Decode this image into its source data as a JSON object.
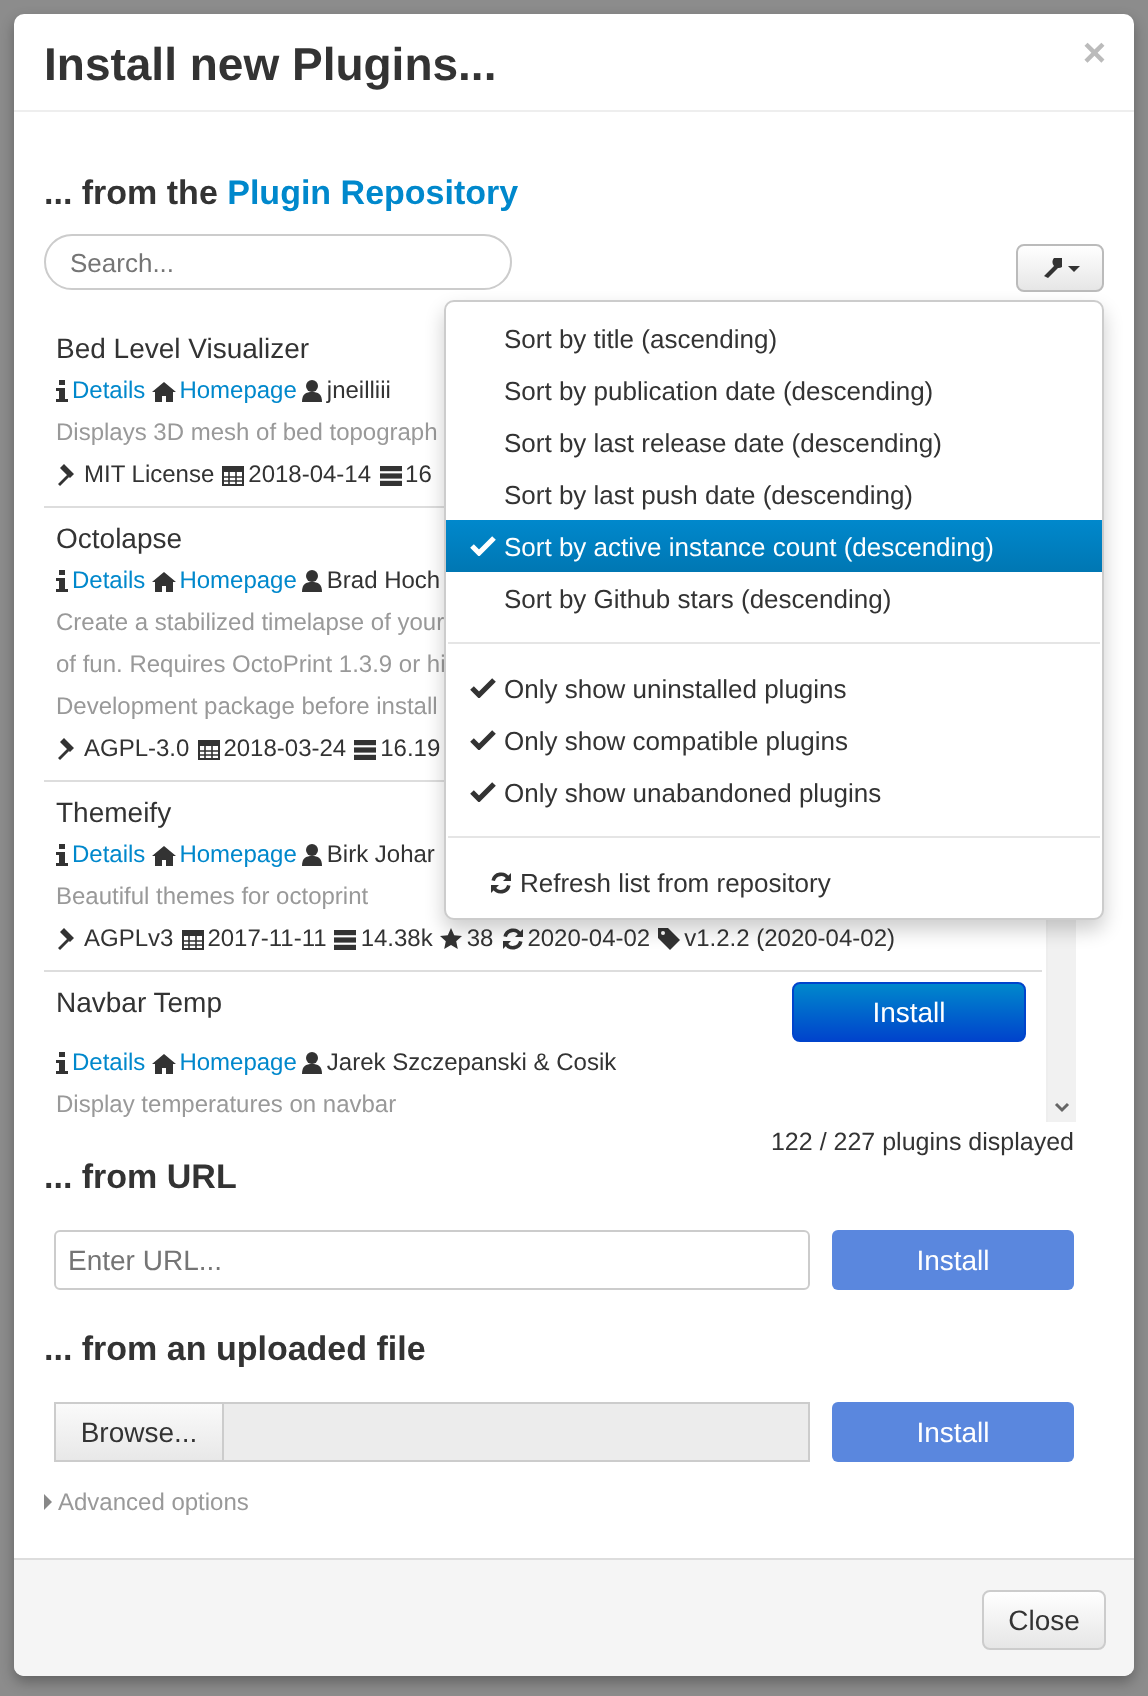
{
  "dialog": {
    "title": "Install new Plugins...",
    "close": "×"
  },
  "repository": {
    "heading": "... from the ",
    "heading_link": "Plugin Repository",
    "search_placeholder": "Search...",
    "plugins": [
      {
        "title": "Bed Level Visualizer",
        "details": "Details",
        "homepage": "Homepage",
        "author": "jneilliii",
        "description": [
          "Displays 3D mesh of bed topograph"
        ],
        "meta": [
          {
            "kind": "license",
            "text": "MIT License"
          },
          {
            "kind": "date",
            "text": "2018-04-14"
          },
          {
            "kind": "instances",
            "text": "16"
          }
        ]
      },
      {
        "title": "Octolapse",
        "details": "Details",
        "homepage": "Homepage",
        "author": "Brad Hoch",
        "description": [
          "Create a stabilized timelapse of your",
          "of fun. Requires OctoPrint 1.3.9 or hi",
          "Development package before install"
        ],
        "meta": [
          {
            "kind": "license",
            "text": "AGPL-3.0"
          },
          {
            "kind": "date",
            "text": "2018-03-24"
          },
          {
            "kind": "instances",
            "text": "16.19"
          }
        ]
      },
      {
        "title": "Themeify",
        "details": "Details",
        "homepage": "Homepage",
        "author": "Birk Johar",
        "description": [
          "Beautiful themes for octoprint"
        ],
        "meta": [
          {
            "kind": "license",
            "text": "AGPLv3"
          },
          {
            "kind": "date",
            "text": "2017-11-11"
          },
          {
            "kind": "instances",
            "text": "14.38k"
          },
          {
            "kind": "stars",
            "text": "38"
          },
          {
            "kind": "updated",
            "text": "2020-04-02"
          },
          {
            "kind": "version",
            "text": "v1.2.2 (2020-04-02)"
          }
        ]
      },
      {
        "title": "Navbar Temp",
        "install": "Install",
        "details": "Details",
        "homepage": "Homepage",
        "author": "Jarek Szczepanski & Cosik",
        "description": [
          "Display temperatures on navbar"
        ]
      }
    ],
    "count": "122 / 227 plugins displayed",
    "menu": {
      "sort_options": [
        {
          "label": "Sort by title (ascending)",
          "selected": false
        },
        {
          "label": "Sort by publication date (descending)",
          "selected": false
        },
        {
          "label": "Sort by last release date (descending)",
          "selected": false
        },
        {
          "label": "Sort by last push date (descending)",
          "selected": false
        },
        {
          "label": "Sort by active instance count (descending)",
          "selected": true
        },
        {
          "label": "Sort by Github stars (descending)",
          "selected": false
        }
      ],
      "filters": [
        {
          "label": "Only show uninstalled plugins",
          "checked": true
        },
        {
          "label": "Only show compatible plugins",
          "checked": true
        },
        {
          "label": "Only show unabandoned plugins",
          "checked": true
        }
      ],
      "refresh": "Refresh list from repository"
    }
  },
  "url": {
    "heading": "... from URL",
    "placeholder": "Enter URL...",
    "install": "Install"
  },
  "upload": {
    "heading": "... from an uploaded file",
    "browse": "Browse...",
    "install": "Install"
  },
  "advanced": "Advanced options",
  "footer": {
    "close": "Close"
  }
}
